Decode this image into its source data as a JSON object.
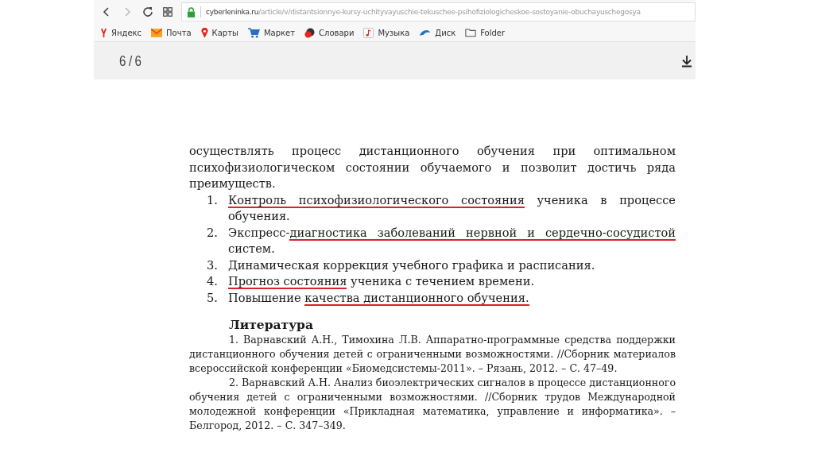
{
  "browser": {
    "back_disabled": false,
    "forward_disabled": true,
    "url": {
      "domain": "cyberleninka.ru",
      "path": "/article/v/distantsionnye-kursy-uchityvayuschie-tekuschee-psihofiziologicheskoe-sostoyanie-obuchayuschegosya"
    },
    "bookmarks": [
      {
        "kind": "yandex",
        "label": "Яндекс"
      },
      {
        "kind": "mail",
        "label": "Почта"
      },
      {
        "kind": "maps",
        "label": "Карты"
      },
      {
        "kind": "market",
        "label": "Маркет"
      },
      {
        "kind": "dictionary",
        "label": "Словари"
      },
      {
        "kind": "music",
        "label": "Музыка"
      },
      {
        "kind": "disk",
        "label": "Диск"
      },
      {
        "kind": "folder",
        "label": "Folder"
      }
    ]
  },
  "pdf_toolbar": {
    "page_counter": "6 / 6"
  },
  "document": {
    "intro": "осуществлять процесс дистанционного обучения при оптимальном психофизиологическом состоянии обучаемого и позволит достичь ряда преимуществ.",
    "list": [
      {
        "number": "1.",
        "segments": [
          {
            "text": "Контроль психофизиологического состояния",
            "underlined": true
          },
          {
            "text": " ученика в процессе обучения.",
            "underlined": false
          }
        ]
      },
      {
        "number": "2.",
        "segments": [
          {
            "text": "Экспресс-",
            "underlined": false
          },
          {
            "text": "диагностика заболеваний нервной и сердечно-сосудистой",
            "underlined": true
          },
          {
            "text": " систем.",
            "underlined": false
          }
        ]
      },
      {
        "number": "3.",
        "segments": [
          {
            "text": "Динамическая коррекция учебного графика и расписания.",
            "underlined": false
          }
        ]
      },
      {
        "number": "4.",
        "segments": [
          {
            "text": "Прогноз состояния",
            "underlined": true
          },
          {
            "text": " ученика с течением времени.",
            "underlined": false
          }
        ]
      },
      {
        "number": "5.",
        "segments": [
          {
            "text": "Повышение ",
            "underlined": false
          },
          {
            "text": "качества дистанционного обучения.",
            "underlined": true
          }
        ]
      }
    ],
    "references_heading": "Литература",
    "references": [
      "1. Варнавский А.Н., Тимохина Л.В. Аппаратно-программные средства поддержки дистанционного обучения детей с ограниченными возможностями. //Сборник материалов всероссийской конференции «Биомедсистемы-2011». – Рязань, 2012. – С. 47–49.",
      "2. Варнавский А.Н. Анализ биоэлектрических сигналов в процессе дистанционного обучения детей с ограниченными возможностями. //Сборник трудов Международной молодежной конференции «Прикладная математика, управление и информатика». – Белгород, 2012. – С. 347–349."
    ]
  }
}
